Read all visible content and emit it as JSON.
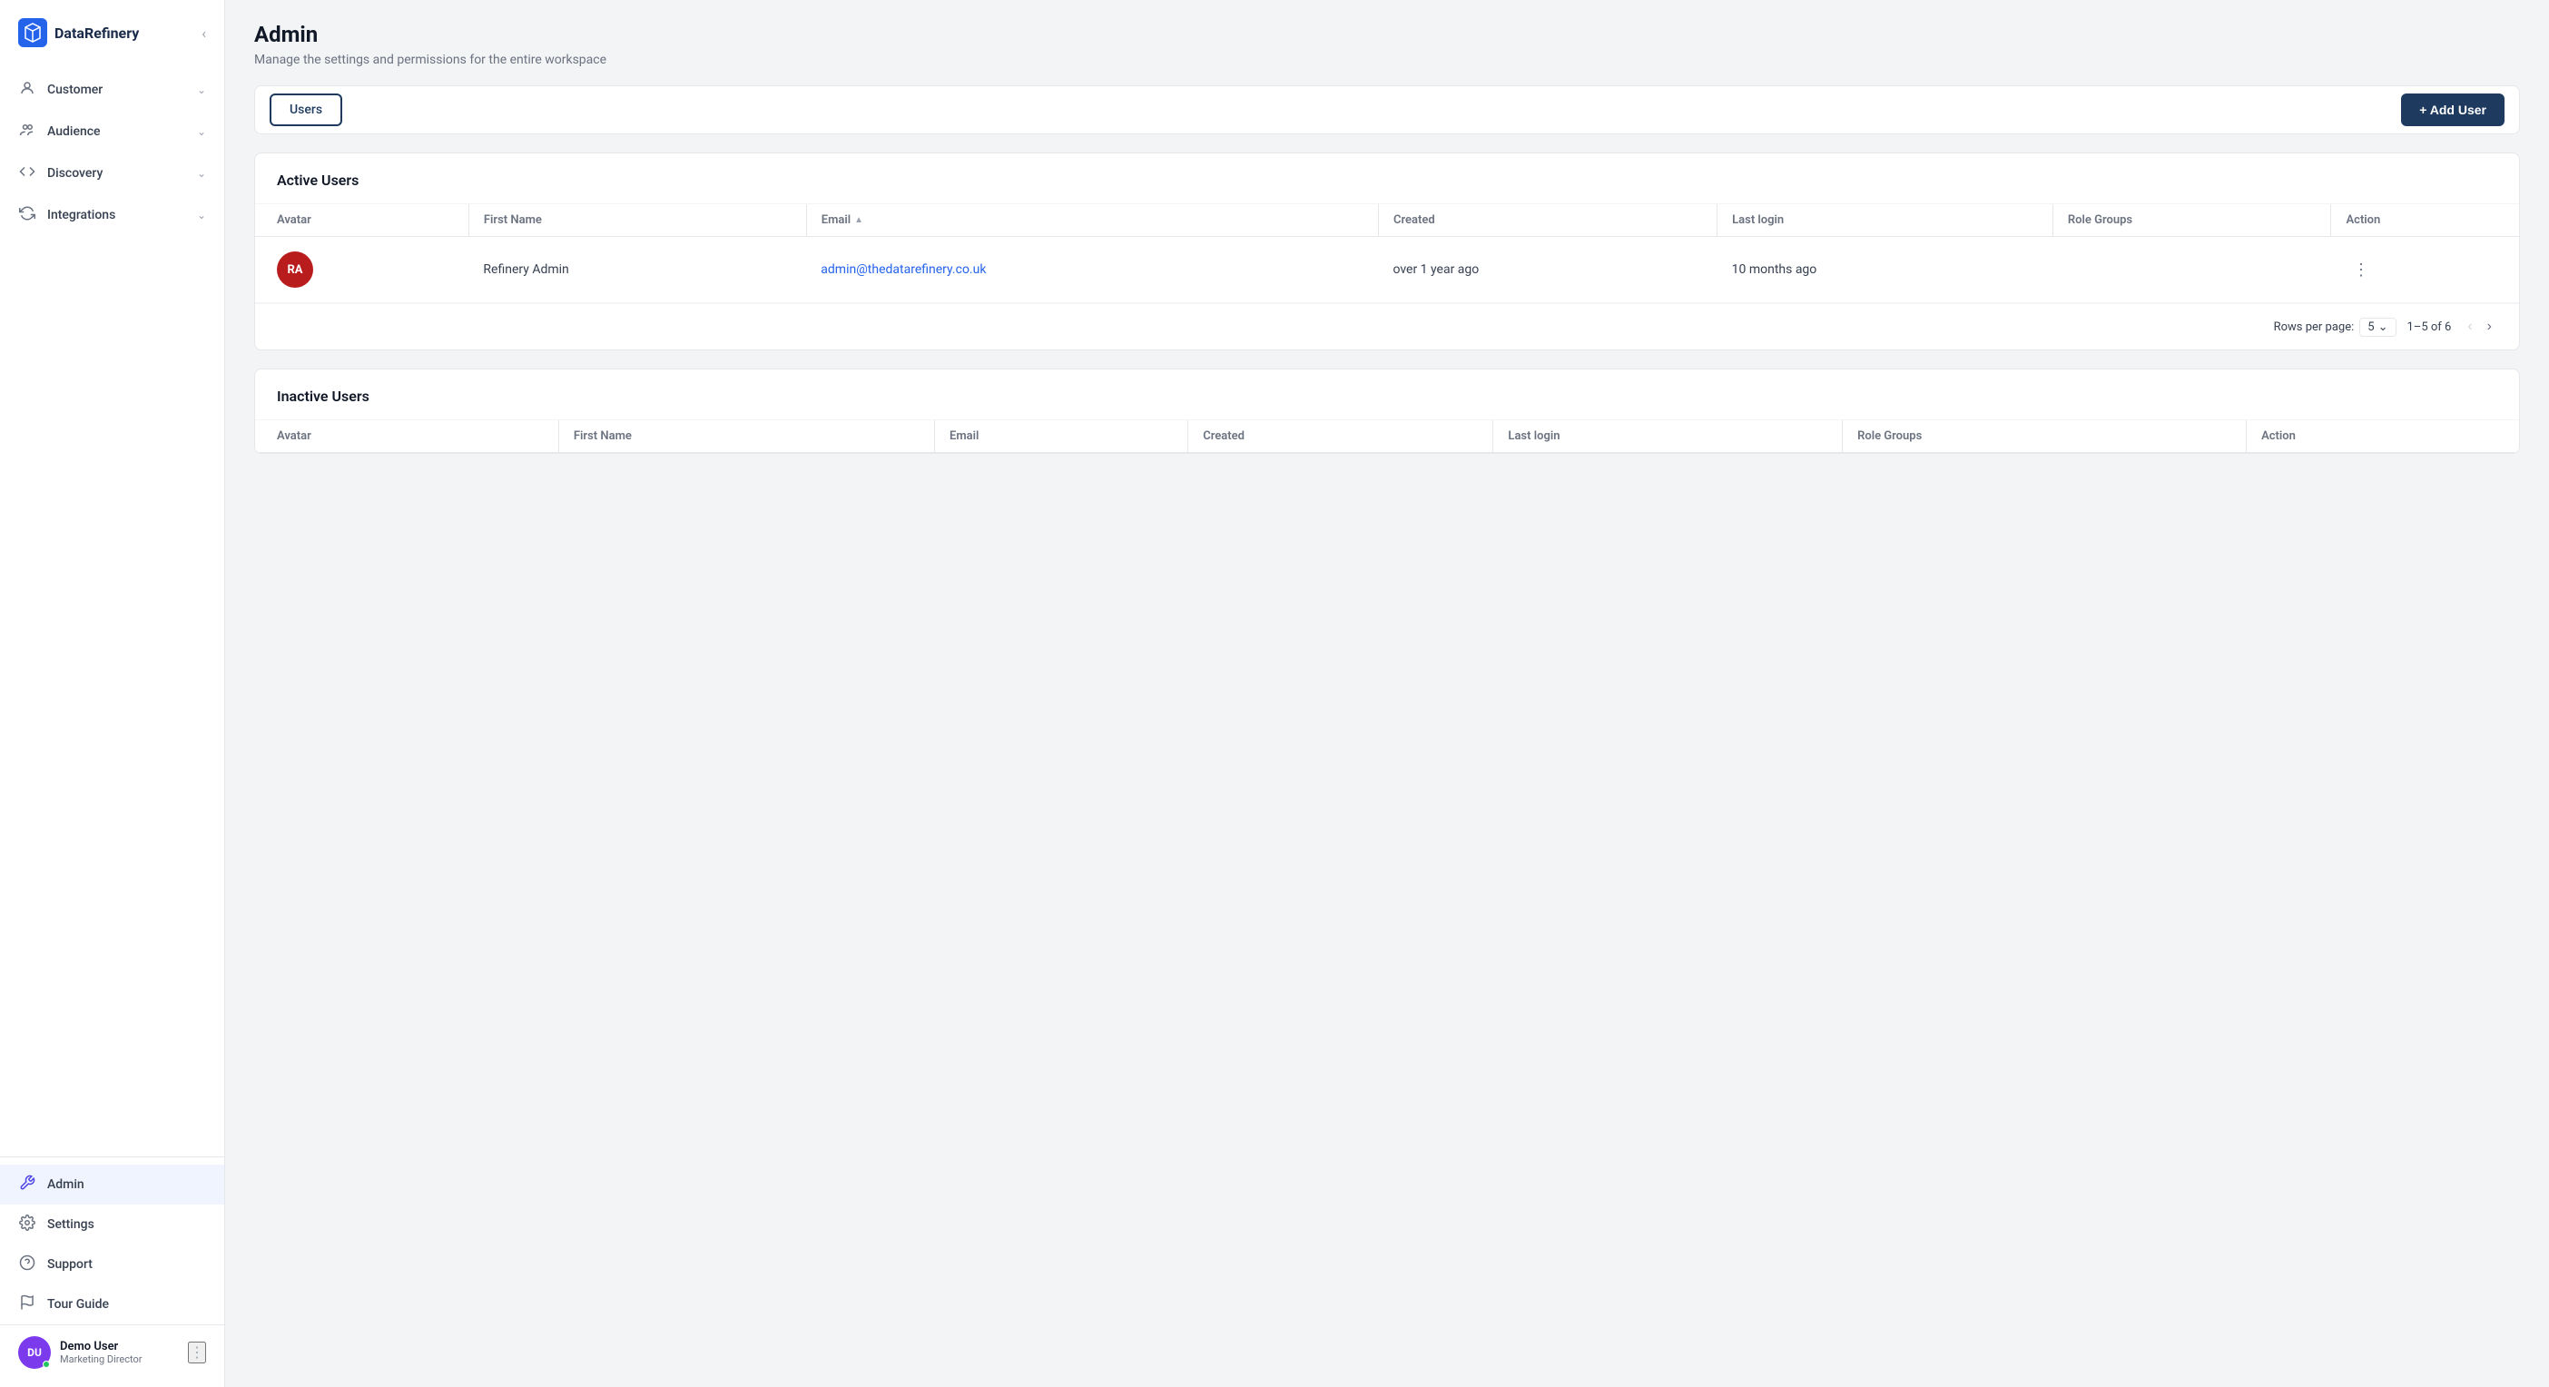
{
  "app": {
    "name": "DataRefinery"
  },
  "sidebar": {
    "collapse_label": "collapse",
    "nav_items": [
      {
        "id": "customer",
        "label": "Customer",
        "icon": "person",
        "has_children": true
      },
      {
        "id": "audience",
        "label": "Audience",
        "icon": "group",
        "has_children": true
      },
      {
        "id": "discovery",
        "label": "Discovery",
        "icon": "code",
        "has_children": true
      },
      {
        "id": "integrations",
        "label": "Integrations",
        "icon": "sync",
        "has_children": true
      }
    ],
    "bottom_items": [
      {
        "id": "admin",
        "label": "Admin",
        "icon": "wrench",
        "active": true
      },
      {
        "id": "settings",
        "label": "Settings",
        "icon": "gear"
      },
      {
        "id": "support",
        "label": "Support",
        "icon": "help"
      },
      {
        "id": "tour",
        "label": "Tour Guide",
        "icon": "flag"
      }
    ],
    "user": {
      "initials": "DU",
      "name": "Demo User",
      "role": "Marketing Director"
    }
  },
  "page": {
    "title": "Admin",
    "subtitle": "Manage the settings and permissions for the entire workspace"
  },
  "tabs": [
    {
      "id": "users",
      "label": "Users",
      "active": true
    }
  ],
  "add_user_button": "+ Add User",
  "active_users": {
    "section_title": "Active Users",
    "columns": [
      {
        "id": "avatar",
        "label": "Avatar"
      },
      {
        "id": "first_name",
        "label": "First Name",
        "sortable": true
      },
      {
        "id": "email",
        "label": "Email",
        "sortable": true,
        "sorted": "asc"
      },
      {
        "id": "created",
        "label": "Created"
      },
      {
        "id": "last_login",
        "label": "Last login"
      },
      {
        "id": "role_groups",
        "label": "Role Groups"
      },
      {
        "id": "action",
        "label": "Action"
      }
    ],
    "rows": [
      {
        "avatar_initials": "RA",
        "avatar_bg": "#b91c1c",
        "first_name": "Refinery Admin",
        "email": "admin@thedatarefinery.co.uk",
        "created": "over 1 year ago",
        "last_login": "10 months ago",
        "role_groups": ""
      }
    ],
    "pagination": {
      "rows_per_page_label": "Rows per page:",
      "rows_per_page_value": "5",
      "page_range": "1–5 of 6"
    }
  },
  "inactive_users": {
    "section_title": "Inactive Users",
    "columns": [
      {
        "id": "avatar",
        "label": "Avatar"
      },
      {
        "id": "first_name",
        "label": "First Name"
      },
      {
        "id": "email",
        "label": "Email"
      },
      {
        "id": "created",
        "label": "Created"
      },
      {
        "id": "last_login",
        "label": "Last login"
      },
      {
        "id": "role_groups",
        "label": "Role Groups"
      },
      {
        "id": "action",
        "label": "Action"
      }
    ],
    "rows": []
  }
}
